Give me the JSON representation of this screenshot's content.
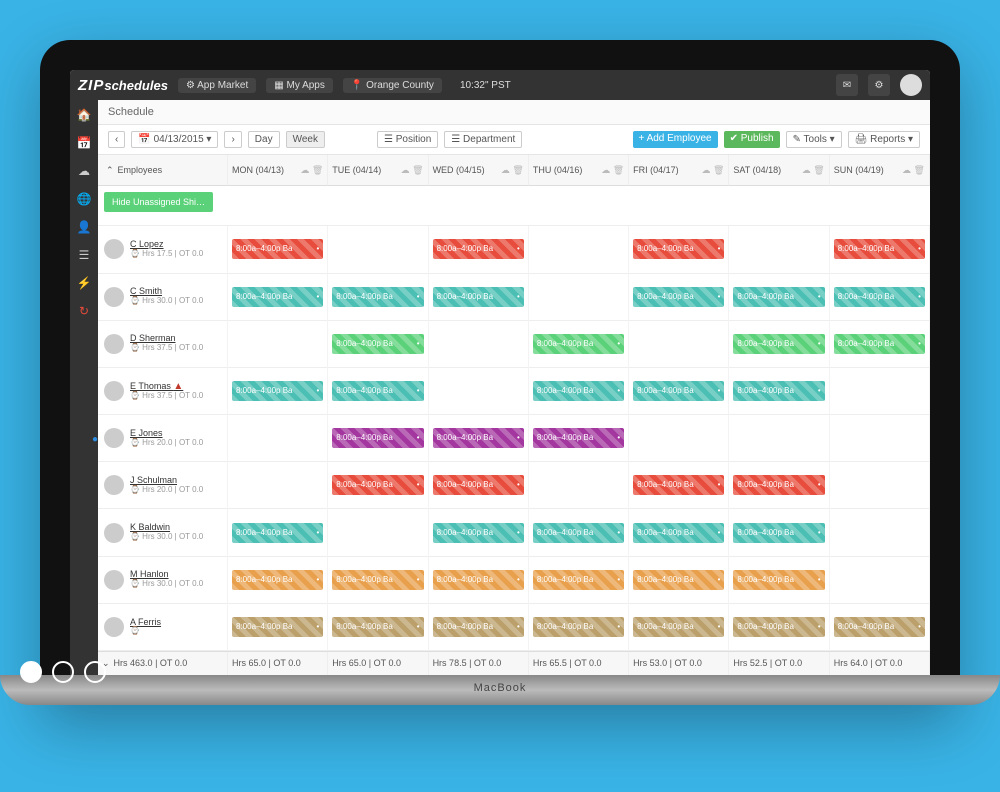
{
  "brand_bold": "ZIP",
  "brand_thin": "schedules",
  "topbar": {
    "app_market": "App Market",
    "my_apps": "My Apps",
    "location": "Orange County",
    "clock": "10:32\" PST"
  },
  "page_title": "Schedule",
  "toolbar": {
    "date": "04/13/2015 ▾",
    "view_day": "Day",
    "view_week": "Week",
    "position": "Position",
    "department": "Department",
    "add_employee": "+ Add Employee",
    "publish": "✔ Publish",
    "tools": "✎ Tools ▾",
    "reports": "🖨 Reports ▾"
  },
  "hide_btn": "Hide Unassigned Shi…",
  "col_label": "Employees",
  "days": [
    {
      "label": "MON (04/13)"
    },
    {
      "label": "TUE (04/14)"
    },
    {
      "label": "WED (04/15)"
    },
    {
      "label": "THU (04/16)"
    },
    {
      "label": "FRI (04/17)"
    },
    {
      "label": "SAT (04/18)"
    },
    {
      "label": "SUN (04/19)"
    }
  ],
  "shift_label": "8:00a–4:00p Ba",
  "employees": [
    {
      "name": "C Lopez",
      "sub": "Hrs 17.5 | OT 0.0",
      "alert": false,
      "dot": false,
      "cells": [
        "red",
        "",
        "red",
        "",
        "red",
        "",
        "red"
      ]
    },
    {
      "name": "C Smith",
      "sub": "Hrs 30.0 | OT 0.0",
      "alert": false,
      "dot": false,
      "cells": [
        "teal",
        "teal",
        "teal",
        "",
        "teal",
        "teal",
        "teal"
      ]
    },
    {
      "name": "D Sherman",
      "sub": "Hrs 37.5 | OT 0.0",
      "alert": false,
      "dot": false,
      "cells": [
        "",
        "green",
        "",
        "green",
        "",
        "green",
        "green"
      ]
    },
    {
      "name": "E Thomas",
      "sub": "Hrs 37.5 | OT 0.0",
      "alert": true,
      "dot": false,
      "cells": [
        "teal",
        "teal",
        "",
        "teal",
        "teal",
        "teal",
        ""
      ]
    },
    {
      "name": "E Jones",
      "sub": "Hrs 20.0 | OT 0.0",
      "alert": false,
      "dot": true,
      "cells": [
        "",
        "mag",
        "mag",
        "mag",
        "",
        "",
        ""
      ]
    },
    {
      "name": "J Schulman",
      "sub": "Hrs 20.0 | OT 0.0",
      "alert": false,
      "dot": false,
      "cells": [
        "",
        "red",
        "red",
        "",
        "red",
        "red",
        ""
      ]
    },
    {
      "name": "K Baldwin",
      "sub": "Hrs 30.0 | OT 0.0",
      "alert": false,
      "dot": false,
      "cells": [
        "teal",
        "",
        "teal",
        "teal",
        "teal",
        "teal",
        ""
      ]
    },
    {
      "name": "M Hanlon",
      "sub": "Hrs 30.0 | OT 0.0",
      "alert": false,
      "dot": false,
      "cells": [
        "orange",
        "orange",
        "orange",
        "orange",
        "orange",
        "orange",
        ""
      ]
    },
    {
      "name": "A Ferris",
      "sub": "",
      "alert": false,
      "dot": false,
      "cells": [
        "tan",
        "tan",
        "tan",
        "tan",
        "tan",
        "tan",
        "tan"
      ]
    }
  ],
  "footer": {
    "total": "Hrs 463.0 | OT 0.0",
    "days": [
      "Hrs 65.0 | OT 0.0",
      "Hrs 65.0 | OT 0.0",
      "Hrs 78.5 | OT 0.0",
      "Hrs 65.5 | OT 0.0",
      "Hrs 53.0 | OT 0.0",
      "Hrs 52.5 | OT 0.0",
      "Hrs 64.0 | OT 0.0"
    ]
  },
  "macbook": "MacBook"
}
